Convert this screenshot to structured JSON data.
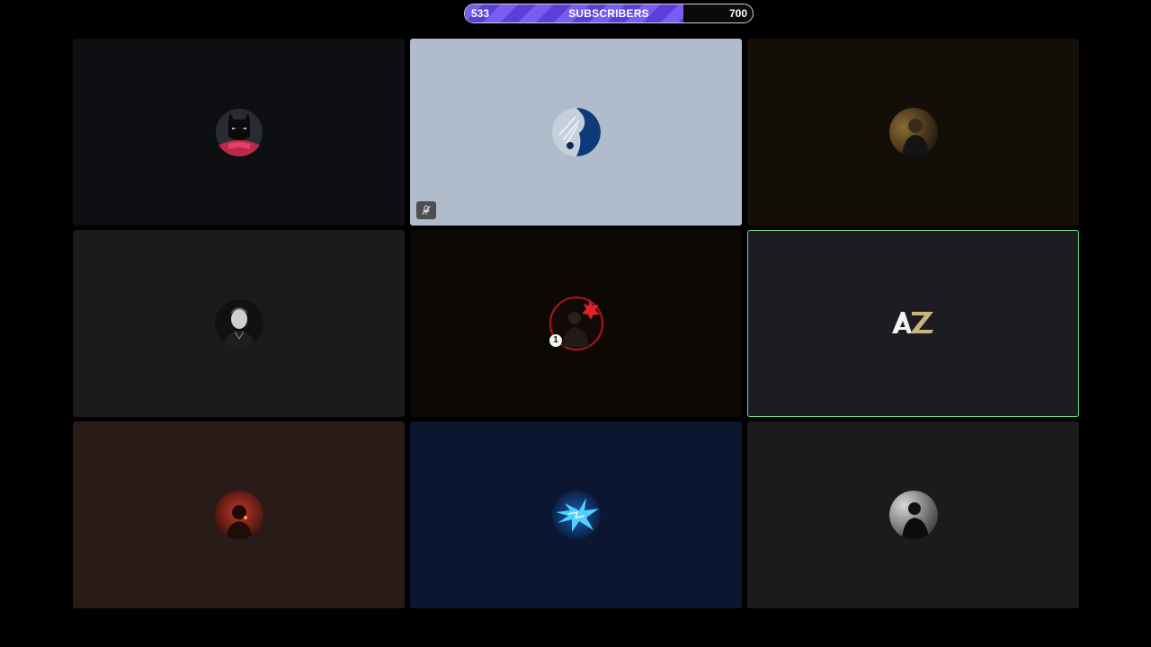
{
  "goal": {
    "current": "533",
    "label": "SUBSCRIBERS",
    "target": "700",
    "progress_fraction": 0.76,
    "fill_color": "#6b4ce6"
  },
  "participants": [
    {
      "avatar": "batman-hood-avatar",
      "background": "#0e0f12",
      "speaking": false,
      "muted": false
    },
    {
      "avatar": "blue-silhouette-avatar",
      "background": "#b0bccb",
      "speaking": false,
      "muted": true
    },
    {
      "avatar": "man-portrait-dark-avatar",
      "background": "#140e08",
      "speaking": false,
      "muted": false
    },
    {
      "avatar": "man-portrait-bw-avatar",
      "background": "#1b1b1b",
      "speaking": false,
      "muted": false
    },
    {
      "avatar": "red-ring-figure-avatar",
      "background": "#0c0905",
      "speaking": false,
      "muted": false,
      "badge": "1"
    },
    {
      "avatar": "az-logo-avatar",
      "background": "#1c1c22",
      "speaking": true,
      "muted": false,
      "logo_text": "AZ"
    },
    {
      "avatar": "red-smoke-avatar",
      "background": "#291b18",
      "speaking": false,
      "muted": false
    },
    {
      "avatar": "blue-lightning-avatar",
      "background": "#0c1630",
      "speaking": false,
      "muted": false
    },
    {
      "avatar": "dark-figure-avatar",
      "background": "#1b1b1b",
      "speaking": false,
      "muted": false
    }
  ],
  "colors": {
    "page_background": "#000000",
    "speaking_border": "#6fdc7a"
  }
}
